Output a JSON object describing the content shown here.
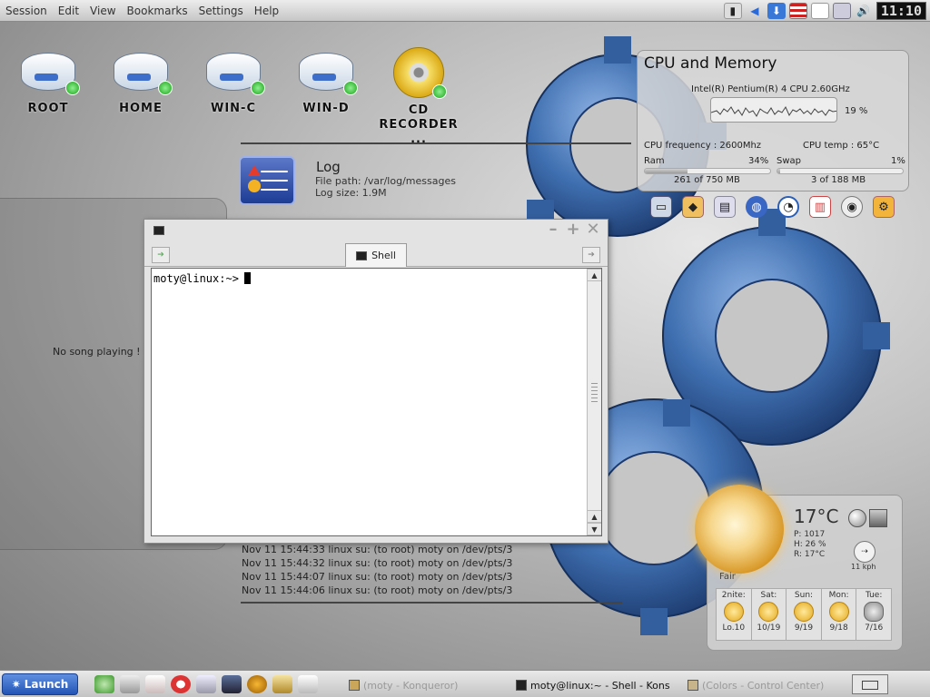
{
  "menubar": {
    "items": [
      "Session",
      "Edit",
      "View",
      "Bookmarks",
      "Settings",
      "Help"
    ],
    "clock": "11:10",
    "tray_icons": [
      "disk-icon",
      "arrow-icon",
      "shield-icon",
      "us-flag-icon",
      "clipboard-icon",
      "printer-icon",
      "volume-icon"
    ]
  },
  "desktop": {
    "icons": [
      {
        "label": "ROOT",
        "icon": "drive-icon"
      },
      {
        "label": "HOME",
        "icon": "drive-icon"
      },
      {
        "label": "WIN-C",
        "icon": "drive-icon"
      },
      {
        "label": "WIN-D",
        "icon": "drive-icon"
      },
      {
        "label": "CD RECORDER ...",
        "icon": "cd-icon"
      }
    ]
  },
  "media_player": {
    "status": "No song playing !"
  },
  "log_widget": {
    "title": "Log",
    "file_path": "File path: /var/log/messages",
    "size": "Log size: 1.9M",
    "entries": [
      "Nov 11 15:44:33 linux su: (to root) moty on /dev/pts/3",
      "Nov 11 15:44:32 linux su: (to root) moty on /dev/pts/3",
      "Nov 11 15:44:07 linux su: (to root) moty on /dev/pts/3",
      "Nov 11 15:44:06 linux su: (to root) moty on /dev/pts/3"
    ]
  },
  "terminal": {
    "tab_label": "Shell",
    "prompt": "moty@linux:~>",
    "buttons": {
      "minimize": "–",
      "maximize": "+",
      "close": "✕"
    }
  },
  "cpu_widget": {
    "title": "CPU and Memory",
    "model": "Intel(R) Pentium(R) 4 CPU 2.60GHz",
    "usage": "19 %",
    "frequency": "CPU frequency : 2600Mhz",
    "temp": "CPU temp : 65°C",
    "ram_label": "Ram",
    "ram_pct": "34%",
    "ram_used": "261 of 750 MB",
    "ram_fraction": 0.34,
    "swap_label": "Swap",
    "swap_pct": "1%",
    "swap_used": "3 of 188 MB",
    "swap_fraction": 0.01,
    "icons": [
      "monitor-icon",
      "network-icon",
      "harddisk-icon",
      "globe-icon",
      "clock-icon",
      "document-icon",
      "disc-icon",
      "config-icon"
    ]
  },
  "weather_widget": {
    "temp": "17°C",
    "pressure": "P:  1017",
    "humidity": "H:  26 %",
    "real_feel": "R:  17°C",
    "wind": "11 kph",
    "condition": "Fair",
    "forecast": [
      {
        "day": "2nite:",
        "temps": "Lo.10",
        "icon": "sun-icon"
      },
      {
        "day": "Sat:",
        "temps": "10/19",
        "icon": "sun-icon"
      },
      {
        "day": "Sun:",
        "temps": "9/19",
        "icon": "sun-icon"
      },
      {
        "day": "Mon:",
        "temps": "9/18",
        "icon": "sun-icon"
      },
      {
        "day": "Tue:",
        "temps": "7/16",
        "icon": "cloud-icon"
      }
    ]
  },
  "taskbar": {
    "launch_label": "Launch",
    "quick_icons": [
      "search-icon",
      "printer-icon",
      "mail-icon",
      "help-icon",
      "tools-icon",
      "ksysguard-icon",
      "bird-icon",
      "file-icon",
      "edit-icon"
    ],
    "tasks": [
      {
        "label": "(moty - Konqueror)",
        "active": false
      },
      {
        "label": "moty@linux:~ - Shell - Kons",
        "active": true
      },
      {
        "label": "(Colors - Control Center)",
        "active": false
      }
    ]
  }
}
